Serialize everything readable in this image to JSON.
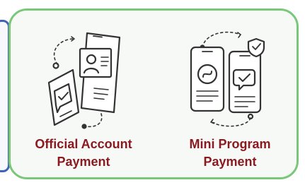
{
  "payment_options": [
    {
      "title_line1": "Official Account",
      "title_line2": "Payment",
      "illustration_icon": "phone-pair-id-card-icon"
    },
    {
      "title_line1": "Mini Program",
      "title_line2": "Payment",
      "illustration_icon": "phone-pair-link-icon"
    }
  ],
  "colors": {
    "panel_border": "#7bc77a",
    "label_text": "#8b1a20",
    "left_card_border": "#3f63b8",
    "illustration_stroke": "#333333"
  }
}
